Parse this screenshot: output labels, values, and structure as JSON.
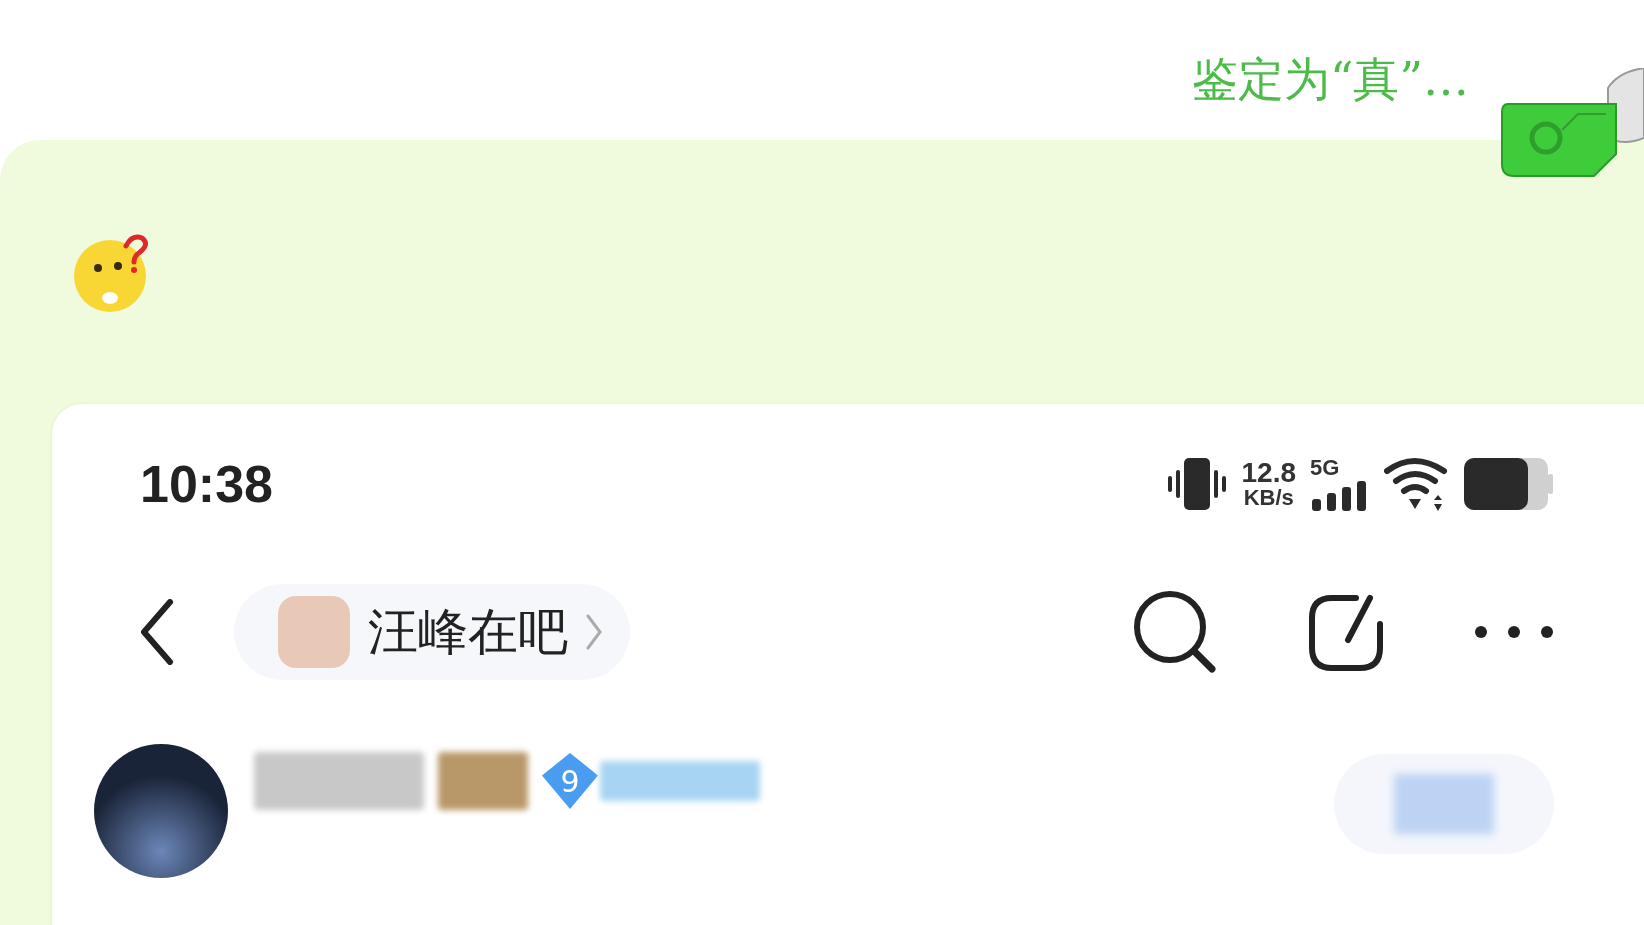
{
  "chat_message": {
    "caption": "鉴定为“真”…"
  },
  "screenshot": {
    "status_bar": {
      "time": "10:38",
      "speed": "12.8",
      "speed_unit": "KB/s",
      "network": "5G"
    },
    "nav": {
      "title": "汪峰在吧"
    },
    "post": {
      "level_badge": "9"
    }
  }
}
